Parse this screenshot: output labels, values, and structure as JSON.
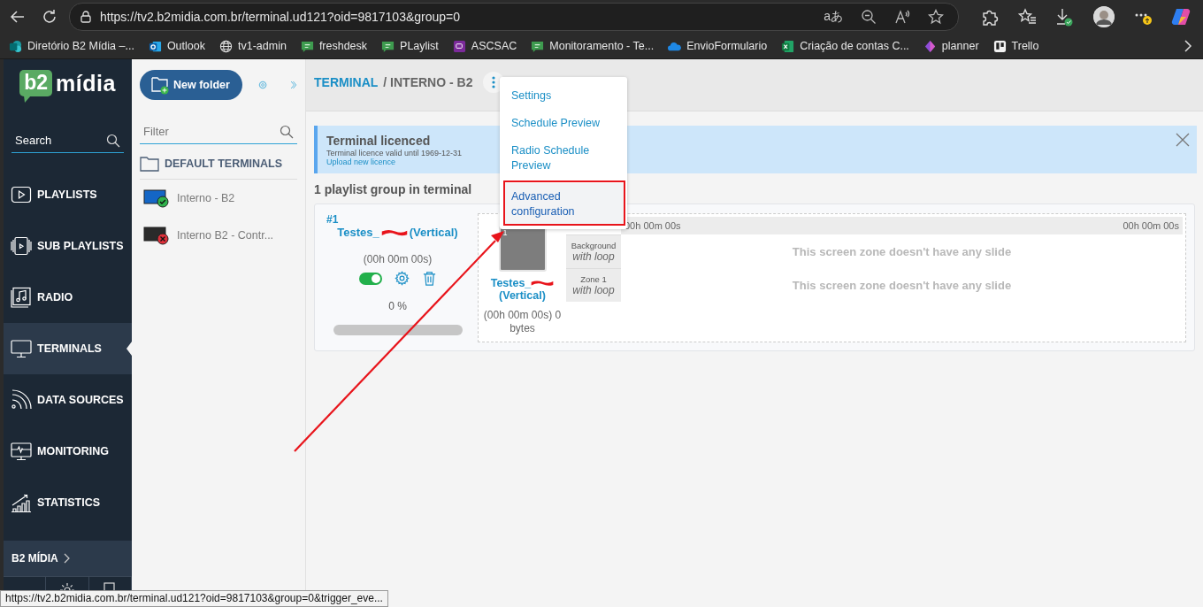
{
  "browser": {
    "url": "https://tv2.b2midia.com.br/terminal.ud121?oid=9817103&group=0",
    "translate_glyph": "aあ",
    "bookmarks": [
      {
        "label": "Diretório B2 Mídia –..."
      },
      {
        "label": "Outlook"
      },
      {
        "label": "tv1-admin"
      },
      {
        "label": "freshdesk"
      },
      {
        "label": "PLaylist"
      },
      {
        "label": "ASCSAC"
      },
      {
        "label": "Monitoramento - Te..."
      },
      {
        "label": "EnvioFormulario"
      },
      {
        "label": "Criação de contas C..."
      },
      {
        "label": "planner"
      },
      {
        "label": "Trello"
      }
    ]
  },
  "sidebar": {
    "logo": {
      "mark": "b2",
      "text": "mídia"
    },
    "search": {
      "placeholder": "Search"
    },
    "items": [
      {
        "label": "PLAYLISTS",
        "selected": false
      },
      {
        "label": "SUB PLAYLISTS",
        "selected": false
      },
      {
        "label": "RADIO",
        "selected": false
      },
      {
        "label": "TERMINALS",
        "selected": true
      },
      {
        "label": "DATA SOURCES",
        "selected": false
      },
      {
        "label": "MONITORING",
        "selected": false
      },
      {
        "label": "STATISTICS",
        "selected": false
      }
    ],
    "section": "B2 MÍDIA"
  },
  "folders": {
    "new_folder": "New folder",
    "filter": {
      "placeholder": "Filter"
    },
    "folder": "DEFAULT TERMINALS",
    "terminals": [
      {
        "name": "Interno - B2",
        "online": true
      },
      {
        "name": "Interno B2 - Contr...",
        "online": false
      }
    ]
  },
  "main": {
    "breadcrumb": {
      "root": "TERMINAL",
      "current": "/ INTERNO - B2"
    },
    "menu": [
      {
        "label": "Settings",
        "highlighted": false
      },
      {
        "label": "Schedule Preview",
        "highlighted": false
      },
      {
        "label": "Radio Schedule Preview",
        "highlighted": false
      },
      {
        "label": "Advanced configuration",
        "highlighted": true
      }
    ],
    "alert": {
      "title": "Terminal licenced",
      "text": "Terminal licence valid until 1969-12-31",
      "link": "Upload new licence"
    },
    "group_count": "1 playlist group in terminal",
    "group": {
      "number": "#1",
      "name": "Testes_",
      "orientation": "(Vertical)",
      "duration": "(00h 00m 00s)",
      "enabled": true,
      "progress_label": "0 %",
      "level": 0,
      "playlist": {
        "thumb_number": "1",
        "name": "Testes_",
        "orientation": "(Vertical)",
        "info": "(00h 00m 00s) 0 bytes"
      },
      "timeline": {
        "start": "00h 00m 00s",
        "end": "00h 00m 00s"
      },
      "zones": [
        {
          "name": "Background",
          "mode": "with loop",
          "message": "This screen zone doesn't have any slide"
        },
        {
          "name": "Zone 1",
          "mode": "with loop",
          "message": "This screen zone doesn't have any slide"
        }
      ]
    }
  },
  "status_url": "https://tv2.b2midia.com.br/terminal.ud121?oid=9817103&group=0&trigger_eve..."
}
